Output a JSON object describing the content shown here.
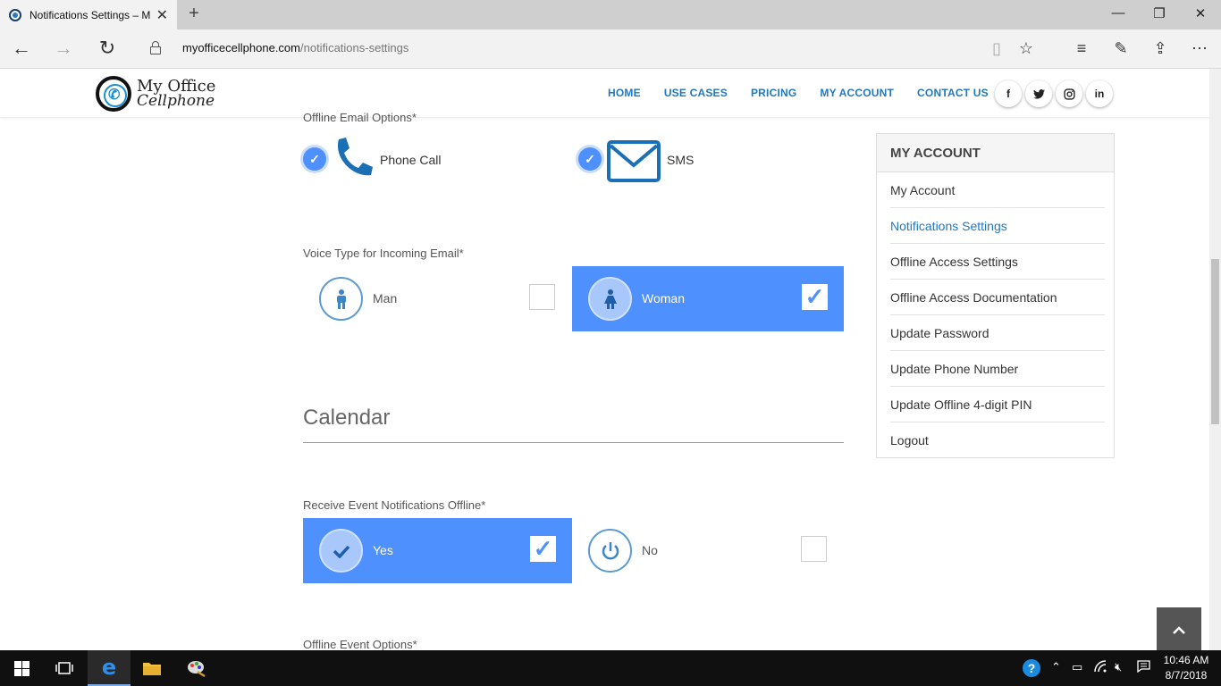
{
  "browser": {
    "tab_title": "Notifications Settings – M",
    "url_domain": "myofficecellphone.com",
    "url_path": "/notifications-settings"
  },
  "site": {
    "logo_line1": "My Office",
    "logo_line2": "Cellphone",
    "nav": [
      "HOME",
      "USE CASES",
      "PRICING",
      "MY ACCOUNT",
      "CONTACT US"
    ],
    "social": [
      "f",
      "t",
      "ig",
      "in"
    ]
  },
  "email_options": {
    "label": "Offline Email Options*",
    "phone_call": "Phone Call",
    "sms": "SMS",
    "phone_call_checked": true,
    "sms_checked": true
  },
  "voice_type": {
    "label": "Voice Type for Incoming Email*",
    "man": "Man",
    "woman": "Woman",
    "selected": "Woman"
  },
  "calendar": {
    "title": "Calendar",
    "event_label": "Receive Event Notifications Offline*",
    "yes": "Yes",
    "no": "No",
    "selected": "Yes",
    "offline_event_options": "Offline Event Options*"
  },
  "sidebar": {
    "title": "MY ACCOUNT",
    "items": [
      "My Account",
      "Notifications Settings",
      "Offline Access Settings",
      "Offline Access Documentation",
      "Update Password",
      "Update Phone Number",
      "Update Offline 4-digit PIN",
      "Logout"
    ],
    "active": "Notifications Settings"
  },
  "taskbar": {
    "time": "10:46 AM",
    "date": "8/7/2018"
  },
  "colors": {
    "accent": "#4d90fe",
    "nav_link": "#1f78c1",
    "icon_blue": "#1a6fb5"
  },
  "icons": {
    "check": "✓",
    "up": "⌃"
  }
}
